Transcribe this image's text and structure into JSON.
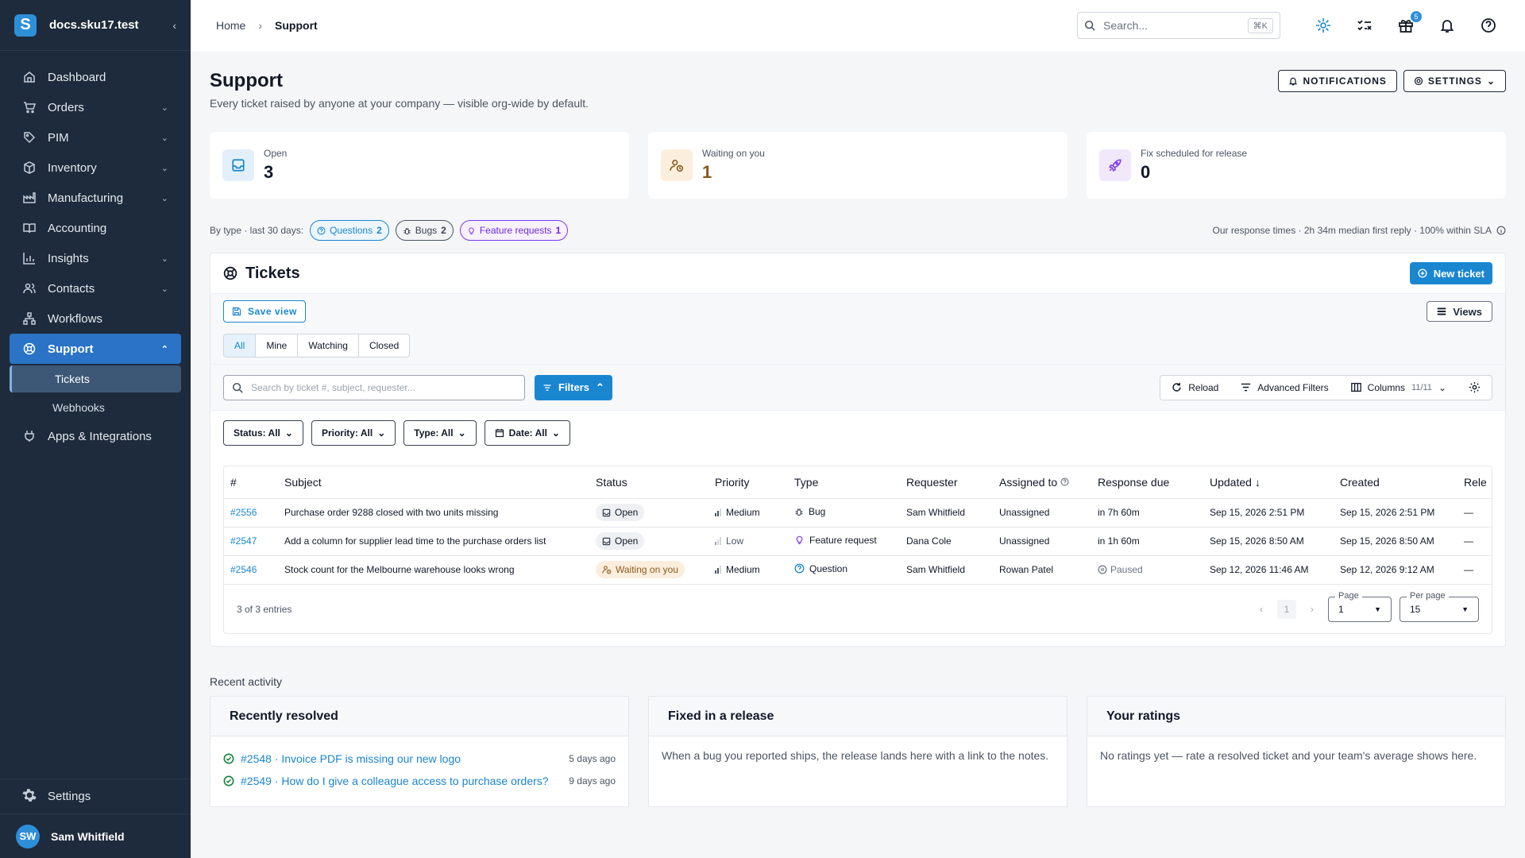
{
  "sidebar": {
    "org": "docs.sku17.test",
    "items": [
      {
        "label": "Dashboard"
      },
      {
        "label": "Orders"
      },
      {
        "label": "PIM"
      },
      {
        "label": "Inventory"
      },
      {
        "label": "Manufacturing"
      },
      {
        "label": "Accounting"
      },
      {
        "label": "Insights"
      },
      {
        "label": "Contacts"
      },
      {
        "label": "Workflows"
      },
      {
        "label": "Support"
      },
      {
        "label": "Apps & Integrations"
      }
    ],
    "support_sub": [
      {
        "label": "Tickets"
      },
      {
        "label": "Webhooks"
      }
    ],
    "settings": "Settings",
    "user": {
      "initials": "SW",
      "name": "Sam Whitfield"
    }
  },
  "topbar": {
    "breadcrumb": [
      "Home",
      "Support"
    ],
    "search_placeholder": "Search...",
    "search_shortcut": "⌘K",
    "gift_badge": "5"
  },
  "page": {
    "title": "Support",
    "subtitle": "Every ticket raised by anyone at your company — visible org-wide by default.",
    "notifications_btn": "NOTIFICATIONS",
    "settings_btn": "SETTINGS"
  },
  "stats": [
    {
      "label": "Open",
      "value": "3",
      "color": "#1a86d0"
    },
    {
      "label": "Waiting on you",
      "value": "1",
      "color": "#8a5a1e"
    },
    {
      "label": "Fix scheduled for release",
      "value": "0",
      "color": "#7c3aed"
    }
  ],
  "bytype": {
    "label": "By type · last 30 days:",
    "chips": [
      {
        "label": "Questions",
        "count": "2"
      },
      {
        "label": "Bugs",
        "count": "2"
      },
      {
        "label": "Feature requests",
        "count": "1"
      }
    ],
    "response": "Our response times · 2h 34m median first reply · 100% within SLA"
  },
  "tickets": {
    "title": "Tickets",
    "new_btn": "New ticket",
    "save_view": "Save view",
    "views": "Views",
    "tabs": [
      "All",
      "Mine",
      "Watching",
      "Closed"
    ],
    "search_placeholder": "Search by ticket #, subject, requester...",
    "filters_btn": "Filters",
    "reload": "Reload",
    "advanced": "Advanced Filters",
    "columns": "Columns",
    "columns_count": "11/11",
    "dropdowns": [
      "Status: All",
      "Priority: All",
      "Type: All",
      "Date: All"
    ],
    "headers": [
      "#",
      "Subject",
      "Status",
      "Priority",
      "Type",
      "Requester",
      "Assigned to",
      "Response due",
      "Updated",
      "Created",
      "Rele"
    ],
    "rows": [
      {
        "id": "#2556",
        "subject": "Purchase order 9288 closed with two units missing",
        "status": "Open",
        "priority": "Medium",
        "type": "Bug",
        "requester": "Sam Whitfield",
        "assigned": "Unassigned",
        "due": "in 7h 60m",
        "updated": "Sep 15, 2026 2:51 PM",
        "created": "Sep 15, 2026 2:51 PM",
        "release": "—"
      },
      {
        "id": "#2547",
        "subject": "Add a column for supplier lead time to the purchase orders list",
        "status": "Open",
        "priority": "Low",
        "type": "Feature request",
        "requester": "Dana Cole",
        "assigned": "Unassigned",
        "due": "in 1h 60m",
        "updated": "Sep 15, 2026 8:50 AM",
        "created": "Sep 15, 2026 8:50 AM",
        "release": "—"
      },
      {
        "id": "#2546",
        "subject": "Stock count for the Melbourne warehouse looks wrong",
        "status": "Waiting on you",
        "priority": "Medium",
        "type": "Question",
        "requester": "Sam Whitfield",
        "assigned": "Rowan Patel",
        "due": "Paused",
        "updated": "Sep 12, 2026 11:46 AM",
        "created": "Sep 12, 2026 9:12 AM",
        "release": "—"
      }
    ],
    "entries": "3 of 3 entries",
    "page_label": "Page",
    "page_value": "1",
    "current_page": "1",
    "per_page_label": "Per page",
    "per_page_value": "15"
  },
  "recent": {
    "label": "Recent activity",
    "resolved_title": "Recently resolved",
    "resolved": [
      {
        "text": "#2548 · Invoice PDF is missing our new logo",
        "ago": "5 days ago"
      },
      {
        "text": "#2549 · How do I give a colleague access to purchase orders?",
        "ago": "9 days ago"
      }
    ],
    "release_title": "Fixed in a release",
    "release_text": "When a bug you reported ships, the release lands here with a link to the notes.",
    "ratings_title": "Your ratings",
    "ratings_text": "No ratings yet — rate a resolved ticket and your team's average shows here."
  }
}
